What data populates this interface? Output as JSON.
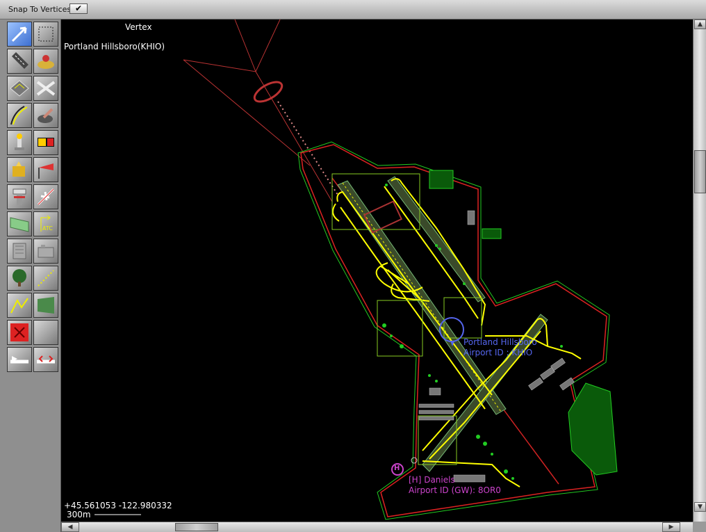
{
  "toolbar": {
    "snap_label": "Snap To Vertices",
    "snap_checked": "✔"
  },
  "map": {
    "tool_name": "Vertex",
    "airport_name": "Portland Hillsboro(KHIO)",
    "coordinates": "+45.561053 -122.980332",
    "scale_label": "300m",
    "airport_label": "Portland Hillsboro",
    "airport_id_label": "Airport ID : KHIO",
    "heliport_symbol": "H",
    "heliport_label": "[H] Daniels",
    "heliport_id_label": "Airport ID (GW): 8OR0"
  },
  "colors": {
    "boundary_red": "#c0392b",
    "boundary_green": "#00ff00",
    "taxi_yellow": "#ffff00",
    "heliport_magenta": "#cc44cc",
    "label_blue": "#5566ee"
  },
  "tools": [
    {
      "name": "vertex-tool-icon"
    },
    {
      "name": "marquee-tool-icon"
    },
    {
      "name": "runway-tool-icon"
    },
    {
      "name": "helipad-tool-icon"
    },
    {
      "name": "taxiway-tool-icon"
    },
    {
      "name": "sealane-tool-icon"
    },
    {
      "name": "taxi-line-tool-icon"
    },
    {
      "name": "boundary-tool-icon"
    },
    {
      "name": "light-fixture-tool-icon"
    },
    {
      "name": "sign-tool-icon"
    },
    {
      "name": "beacon-tool-icon"
    },
    {
      "name": "windsock-tool-icon"
    },
    {
      "name": "tower-tool-icon"
    },
    {
      "name": "ramp-start-tool-icon"
    },
    {
      "name": "facade-tool-icon"
    },
    {
      "name": "atc-frequency-tool-icon"
    },
    {
      "name": "object-tool-icon"
    },
    {
      "name": "building-tool-icon"
    },
    {
      "name": "forest-tool-icon"
    },
    {
      "name": "line-tool-icon"
    },
    {
      "name": "string-tool-icon"
    },
    {
      "name": "polygon-tool-icon"
    },
    {
      "name": "exclusion-tool-icon"
    },
    {
      "name": "blank-tool-icon"
    },
    {
      "name": "taxi-route-tool-icon"
    },
    {
      "name": "truck-route-tool-icon"
    }
  ]
}
